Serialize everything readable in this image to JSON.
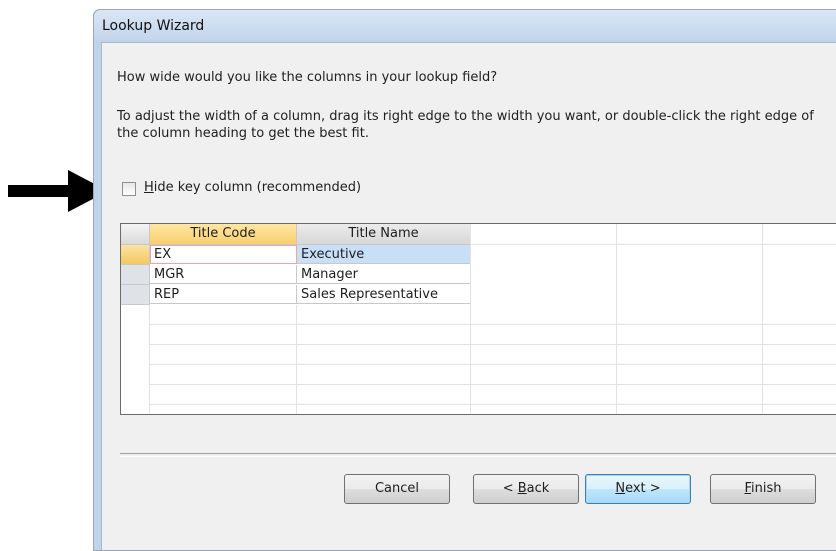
{
  "window": {
    "title": "Lookup Wizard"
  },
  "instructions": {
    "question": "How wide would you like the columns in your lookup field?",
    "detail": "To adjust the width of a column, drag its right edge to the width you want, or double-click the right edge of the column heading to get the best fit."
  },
  "hide_key_column": {
    "label_accel": "H",
    "label_rest": "ide key column (recommended)",
    "checked": false
  },
  "grid": {
    "columns": [
      "Title Code",
      "Title Name"
    ],
    "rows": [
      [
        "EX",
        "Executive"
      ],
      [
        "MGR",
        "Manager"
      ],
      [
        "REP",
        "Sales Representative"
      ]
    ]
  },
  "buttons": {
    "cancel": "Cancel",
    "back_prefix": "< ",
    "back_accel": "B",
    "back_rest": "ack",
    "next_accel": "N",
    "next_rest": "ext >",
    "finish_accel": "F",
    "finish_rest": "inish"
  },
  "annotation": {
    "arrow_icon": "right-arrow-icon",
    "arrow_color": "#000000"
  }
}
